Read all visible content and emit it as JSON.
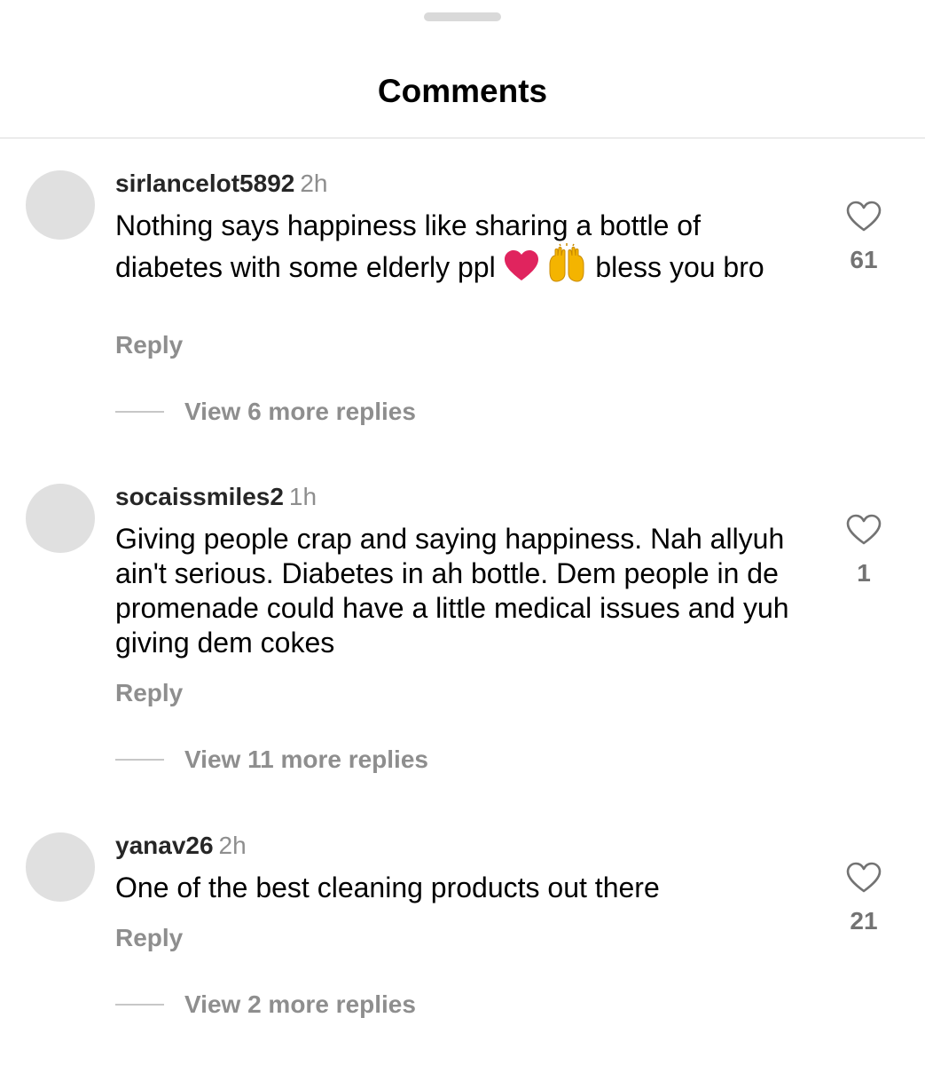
{
  "sheet": {
    "title": "Comments"
  },
  "comments": [
    {
      "username": "sirlancelot5892",
      "time": "2h",
      "text_a": "Nothing says happiness like sharing a bottle of diabetes with some elderly ppl ",
      "emoji_1": "red-heart-emoji",
      "emoji_2": "raising-hands-emoji",
      "text_b": " bless you bro",
      "reply_label": "Reply",
      "more_replies_label": "View 6 more replies",
      "likes": "61"
    },
    {
      "username": "socaissmiles2",
      "time": "1h",
      "text": "Giving people crap and saying happiness.  Nah allyuh ain't serious. Diabetes in ah bottle. Dem people in de promenade could have a little medical issues and yuh giving dem cokes",
      "reply_label": "Reply",
      "more_replies_label": "View 11 more replies",
      "likes": "1"
    },
    {
      "username": "yanav26",
      "time": "2h",
      "text": "One of the best cleaning products out there",
      "reply_label": "Reply",
      "more_replies_label": "View 2 more replies",
      "likes": "21"
    }
  ],
  "colors": {
    "username": "#262626",
    "secondary_text": "#8e8e8e",
    "avatar_placeholder": "#e0e0e0",
    "heart_emoji": "#e0245e",
    "hands_emoji": "#f4b400"
  }
}
